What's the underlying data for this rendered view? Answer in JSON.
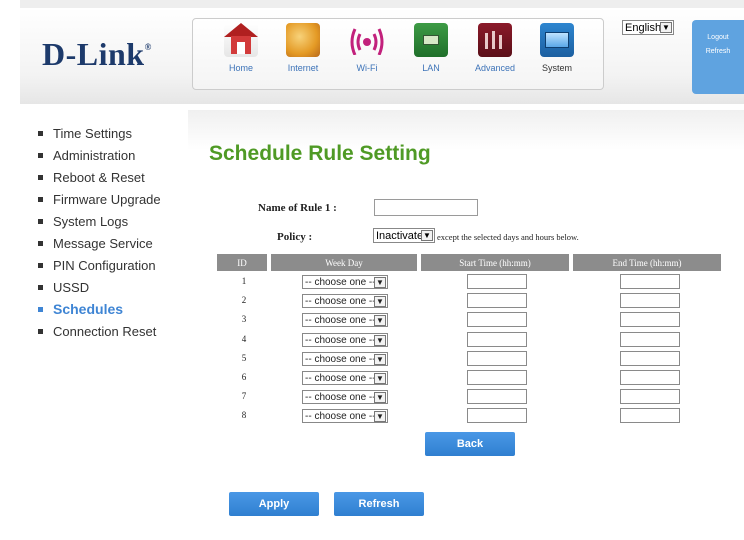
{
  "brand": {
    "name": "D-Link",
    "mark": "®"
  },
  "nav": [
    {
      "label": "Home",
      "icon": "home-icon"
    },
    {
      "label": "Internet",
      "icon": "globe-icon"
    },
    {
      "label": "Wi-Fi",
      "icon": "wifi-icon"
    },
    {
      "label": "LAN",
      "icon": "lan-icon"
    },
    {
      "label": "Advanced",
      "icon": "tools-icon"
    },
    {
      "label": "System",
      "icon": "computer-icon"
    }
  ],
  "active_nav": "System",
  "language": {
    "selected": "English"
  },
  "account": {
    "logout": "Logout",
    "refresh": "Refresh"
  },
  "sidebar": {
    "items": [
      {
        "label": "Time Settings"
      },
      {
        "label": "Administration"
      },
      {
        "label": "Reboot & Reset"
      },
      {
        "label": "Firmware Upgrade"
      },
      {
        "label": "System Logs"
      },
      {
        "label": "Message Service"
      },
      {
        "label": "PIN Configuration"
      },
      {
        "label": "USSD"
      },
      {
        "label": "Schedules"
      },
      {
        "label": "Connection Reset"
      }
    ],
    "active": "Schedules"
  },
  "page": {
    "title": "Schedule Rule Setting",
    "rule_name_label": "Name of Rule 1 :",
    "rule_name_value": "",
    "policy_label": "Policy :",
    "policy_value": "Inactivate",
    "policy_note": "except the selected days and hours below.",
    "table": {
      "headers": {
        "id": "ID",
        "week_day": "Week Day",
        "start": "Start Time (hh:mm)",
        "end": "End Time (hh:mm)"
      },
      "rows": [
        {
          "id": "1",
          "day": "-- choose one --"
        },
        {
          "id": "2",
          "day": "-- choose one --"
        },
        {
          "id": "3",
          "day": "-- choose one --"
        },
        {
          "id": "4",
          "day": "-- choose one --"
        },
        {
          "id": "5",
          "day": "-- choose one --"
        },
        {
          "id": "6",
          "day": "-- choose one --"
        },
        {
          "id": "7",
          "day": "-- choose one --"
        },
        {
          "id": "8",
          "day": "-- choose one --"
        }
      ]
    },
    "buttons": {
      "back": "Back",
      "apply": "Apply",
      "refresh": "Refresh"
    }
  },
  "colors": {
    "title_green": "#4f9a25",
    "accent_blue": "#3f85d4",
    "header_gray": "#8c8c8c"
  }
}
